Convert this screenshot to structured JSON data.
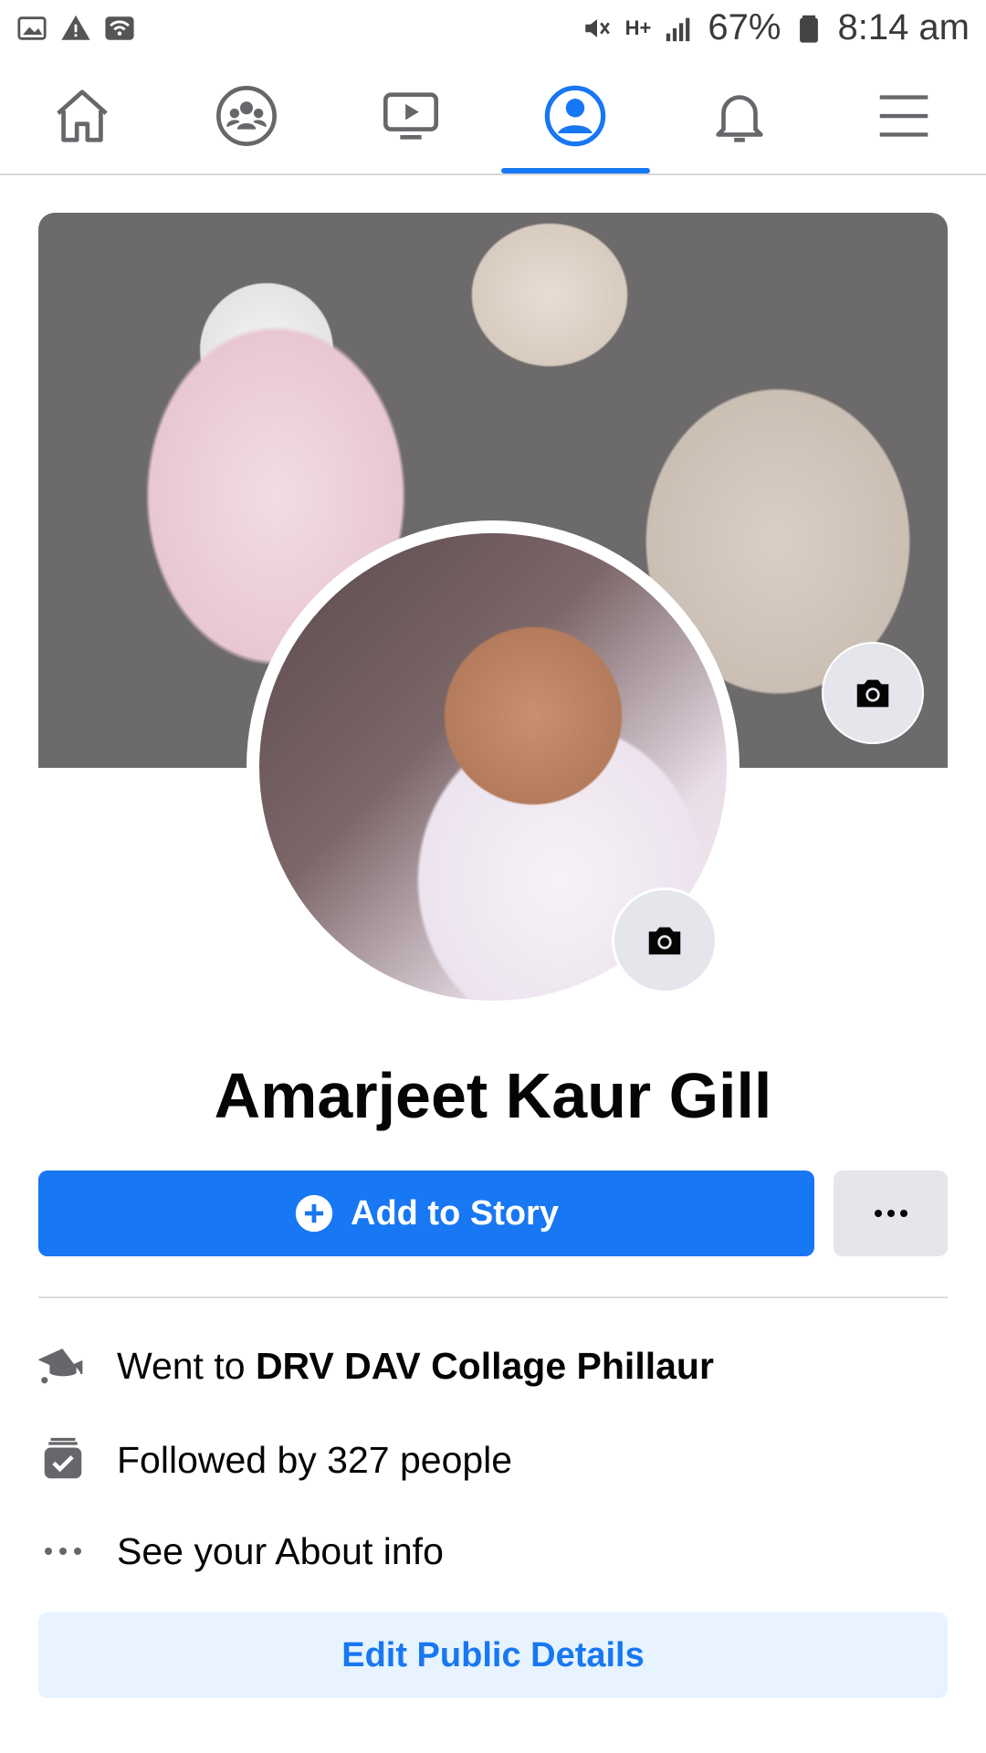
{
  "status_bar": {
    "battery": "67%",
    "time": "8:14 am",
    "network": "H+"
  },
  "nav": {
    "tabs": [
      {
        "name": "home",
        "icon": "home-icon"
      },
      {
        "name": "groups",
        "icon": "groups-icon"
      },
      {
        "name": "watch",
        "icon": "video-icon"
      },
      {
        "name": "profile",
        "icon": "profile-icon",
        "active": true
      },
      {
        "name": "notifications",
        "icon": "bell-icon"
      },
      {
        "name": "menu",
        "icon": "hamburger-icon"
      }
    ]
  },
  "profile": {
    "name": "Amarjeet Kaur Gill"
  },
  "actions": {
    "add_story_label": "Add to Story",
    "more_label": "•••"
  },
  "details": {
    "education_prefix": "Went to ",
    "education_school": "DRV DAV Collage Phillaur",
    "followers": "Followed by 327 people",
    "about": "See your About info",
    "edit_label": "Edit Public Details"
  },
  "colors": {
    "accent": "#1877f2",
    "secondary_button": "#e4e6eb",
    "edit_button_bg": "#e7f3ff"
  }
}
